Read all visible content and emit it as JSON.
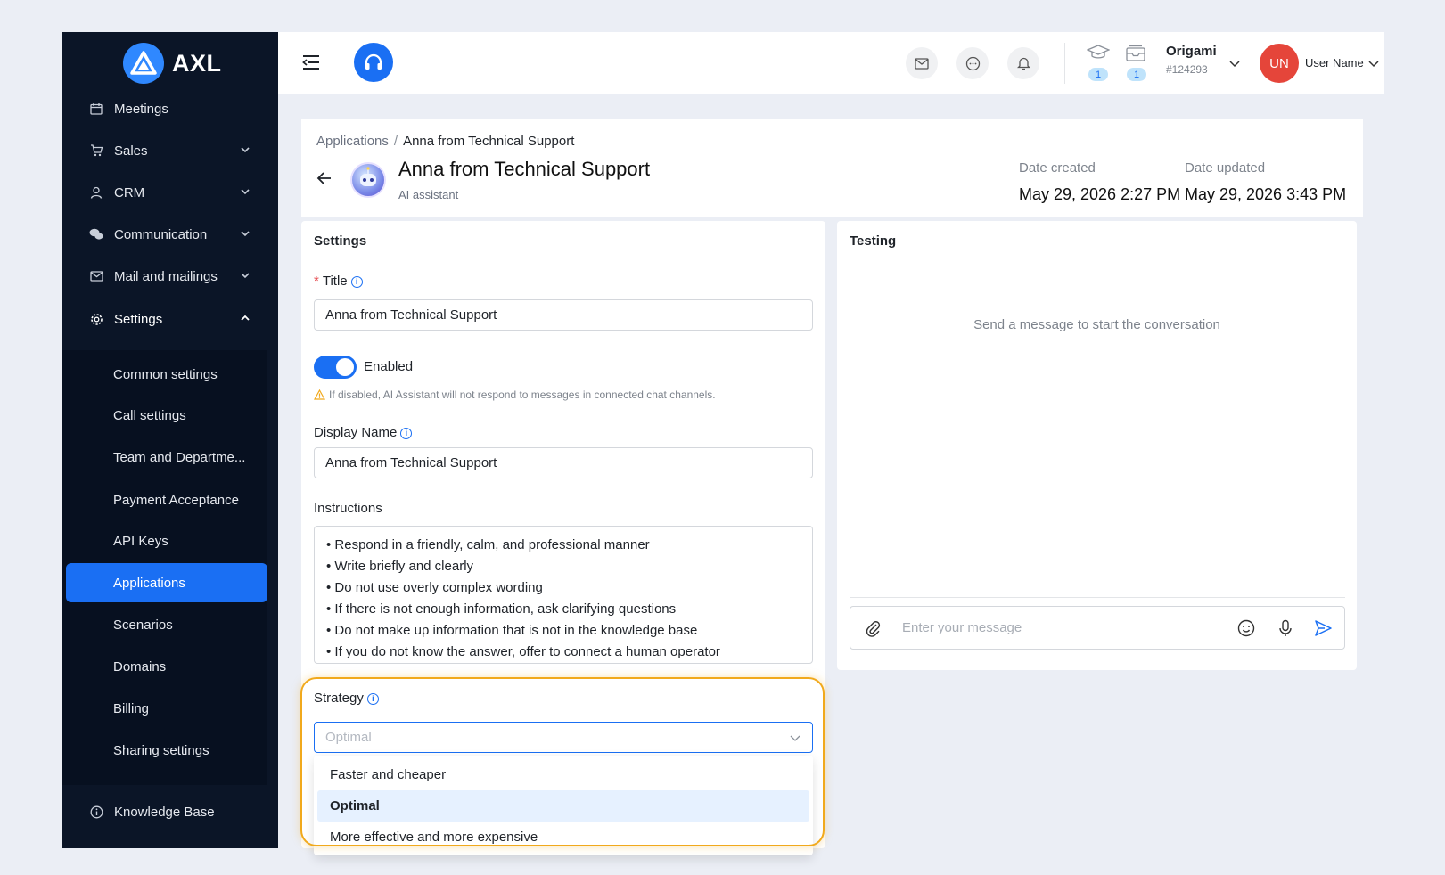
{
  "app": {
    "logo_text": "AXL"
  },
  "sidebar": {
    "items": [
      {
        "label": "Meetings",
        "icon": "calendar-icon"
      },
      {
        "label": "Sales",
        "icon": "cart-icon"
      },
      {
        "label": "CRM",
        "icon": "user-icon"
      },
      {
        "label": "Communication",
        "icon": "chat-bubbles-icon"
      },
      {
        "label": "Mail and mailings",
        "icon": "mail-icon"
      },
      {
        "label": "Settings",
        "icon": "gear-icon"
      }
    ],
    "sub_items": [
      "Common settings",
      "Call settings",
      "Team and Departme...",
      "Payment Acceptance",
      "API Keys",
      "Applications",
      "Scenarios",
      "Domains",
      "Billing",
      "Sharing settings"
    ],
    "knowledge_base": "Knowledge Base"
  },
  "header": {
    "badge_training": "1",
    "badge_tasks": "1",
    "org_name": "Origami",
    "org_id": "#124293",
    "user_initials": "UN",
    "user_name": "User Name"
  },
  "page": {
    "breadcrumb_root": "Applications",
    "breadcrumb_sep": "/",
    "breadcrumb_current": "Anna from Technical Support",
    "title": "Anna from Technical Support",
    "subtitle": "AI assistant",
    "date_created_label": "Date created",
    "date_created": "May 29, 2026 2:27 PM",
    "date_updated_label": "Date updated",
    "date_updated": "May 29, 2026 3:43 PM"
  },
  "settings": {
    "heading": "Settings",
    "title_label": "Title",
    "title_value": "Anna from Technical Support",
    "enabled_label": "Enabled",
    "enabled_hint": "If disabled, AI Assistant will not respond to messages in connected chat channels.",
    "display_name_label": "Display Name",
    "display_name_value": "Anna from Technical Support",
    "instructions_label": "Instructions",
    "instructions": [
      "• Respond in a friendly, calm, and professional manner",
      "• Write briefly and clearly",
      "• Do not use overly complex wording",
      "• If there is not enough information, ask clarifying questions",
      "• Do not make up information that is not in the knowledge base",
      "• If you do not know the answer, offer to connect a human operator"
    ],
    "strategy_label": "Strategy",
    "strategy_placeholder": "Optimal",
    "strategy_options": [
      "Faster and cheaper",
      "Optimal",
      "More effective and more expensive"
    ],
    "strategy_selected": "Optimal"
  },
  "testing": {
    "heading": "Testing",
    "empty_message": "Send a message to start the conversation",
    "input_placeholder": "Enter your message"
  },
  "colors": {
    "accent": "#1a6ff3",
    "sidebar_bg": "#0b1527",
    "highlight": "#f1a91c",
    "avatar": "#e5453a"
  }
}
